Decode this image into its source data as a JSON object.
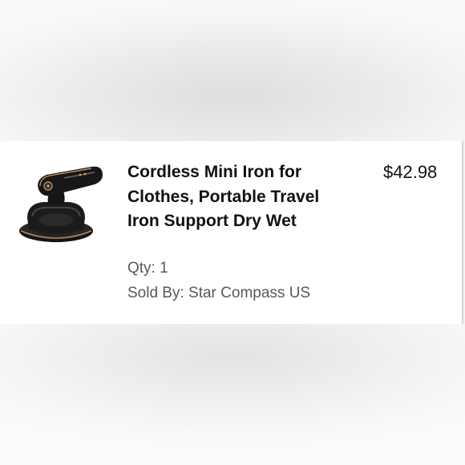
{
  "order_item": {
    "title": "Cordless Mini Iron for Clothes, Portable Travel Iron Support Dry Wet",
    "price": "$42.98",
    "qty": "Qty: 1",
    "sold_by": "Sold By: Star Compass US",
    "image_icon": "mini-iron-product-image"
  }
}
